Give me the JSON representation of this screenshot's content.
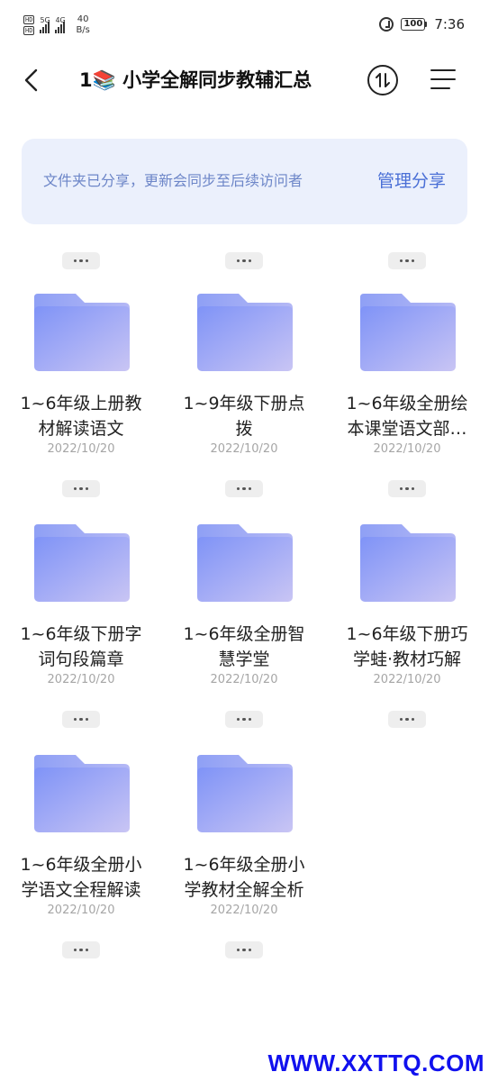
{
  "status_bar": {
    "sim1": "HD",
    "sim2": "HD",
    "signal1_label": "5G",
    "signal2_label": "4G",
    "net_speed": "40",
    "net_unit": "B/s",
    "battery": "100",
    "time": "7:36"
  },
  "header": {
    "title": "1📚 小学全解同步教辅汇总"
  },
  "banner": {
    "text": "文件夹已分享，更新会同步至后续访问者",
    "action_label": "管理分享"
  },
  "folders": [
    {
      "line1": "1~6年级上册教",
      "line2": "材解读语文",
      "date": "2022/10/20"
    },
    {
      "line1": "1~9年级下册点",
      "line2": "拨",
      "date": "2022/10/20"
    },
    {
      "line1": "1~6年级全册绘",
      "line2": "本课堂语文部…",
      "date": "2022/10/20"
    },
    {
      "line1": "1~6年级下册字",
      "line2": "词句段篇章",
      "date": "2022/10/20"
    },
    {
      "line1": "1~6年级全册智",
      "line2": "慧学堂",
      "date": "2022/10/20"
    },
    {
      "line1": "1~6年级下册巧",
      "line2": "学蛙·教材巧解",
      "date": "2022/10/20"
    },
    {
      "line1": "1~6年级全册小",
      "line2": "学语文全程解读",
      "date": "2022/10/20"
    },
    {
      "line1": "1~6年级全册小",
      "line2": "学教材全解全析",
      "date": "2022/10/20"
    }
  ],
  "watermark": "WWW.XXTTQ.COM",
  "colors": {
    "accent": "#4a6fd6",
    "banner_bg": "#ebf0fc",
    "folder_front_start": "#7f93f7",
    "folder_front_end": "#c9c5f4",
    "folder_back": "#95a6f5"
  }
}
